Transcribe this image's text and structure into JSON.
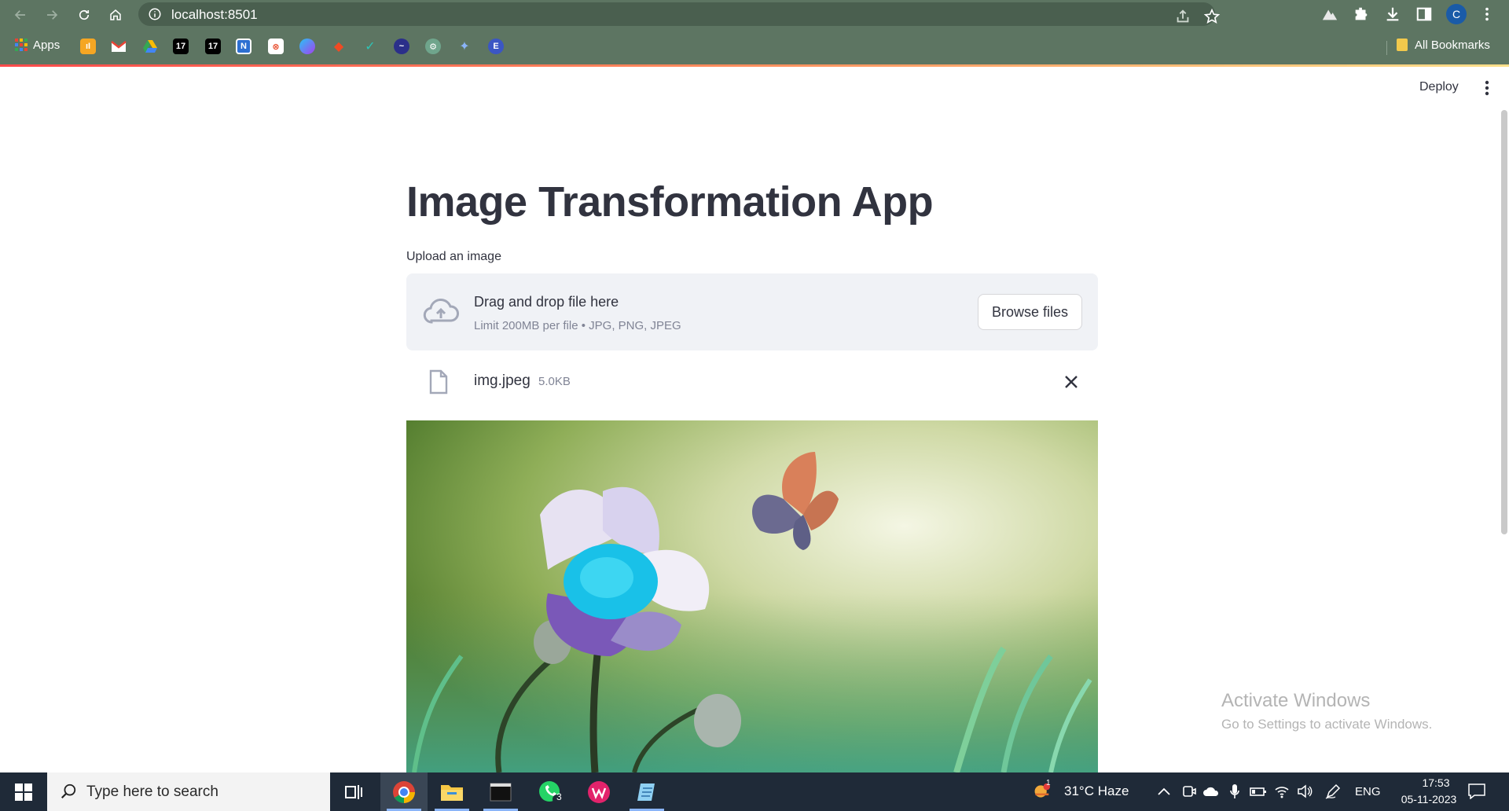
{
  "browser": {
    "url": "localhost:8501",
    "bookmarks_apps_label": "Apps",
    "all_bookmarks_label": "All Bookmarks",
    "profile_initial": "C",
    "bookmark_icons": [
      "tally-icon",
      "gmail-icon",
      "drive-icon",
      "tv-icon",
      "tv-icon-2",
      "n-icon",
      "remote-icon",
      "globe-icon",
      "tag-icon",
      "check-icon",
      "chart-icon",
      "chatgpt-icon",
      "sparkle-icon",
      "e-icon"
    ],
    "bookmark_e_letter": "E"
  },
  "app": {
    "deploy_label": "Deploy",
    "title": "Image Transformation App",
    "upload_label": "Upload an image",
    "dropzone_title": "Drag and drop file here",
    "dropzone_sub": "Limit 200MB per file • JPG, PNG, JPEG",
    "browse_label": "Browse files",
    "file_name": "img.jpeg",
    "file_size": "5.0KB"
  },
  "os": {
    "watermark_title": "Activate Windows",
    "watermark_sub": "Go to Settings to activate Windows.",
    "search_placeholder": "Type here to search",
    "weather": "31°C  Haze",
    "weather_badge": "1",
    "whatsapp_badge": "3",
    "language": "ENG",
    "time": "17:53",
    "date": "05-11-2023"
  },
  "colors": {
    "chrome": "#5d7562",
    "accent": "#ff4b4b",
    "taskbar": "#1f2a38"
  }
}
